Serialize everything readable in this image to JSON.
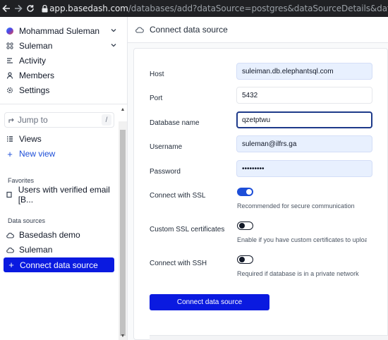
{
  "browser": {
    "url_host": "app.basedash.com",
    "url_path": "/databases/add?dataSource=postgres&dataSourceDetails&dataSourceName=Sulem"
  },
  "sidebar": {
    "user_name": "Mohammad Suleman",
    "workspace": "Suleman",
    "nav": {
      "activity": "Activity",
      "members": "Members",
      "settings": "Settings"
    },
    "jump_to": "Jump to",
    "jump_shortcut": "/",
    "views": "Views",
    "new_view": "New view",
    "favorites_heading": "Favorites",
    "favorite_item": "Users with verified email [B...",
    "data_sources_heading": "Data sources",
    "sources": [
      "Basedash demo",
      "Suleman"
    ],
    "connect_data_source": "Connect data source"
  },
  "main": {
    "title": "Connect data source",
    "form": {
      "host_label": "Host",
      "host_value": "suleiman.db.elephantsql.com",
      "port_label": "Port",
      "port_value": "5432",
      "dbname_label": "Database name",
      "dbname_value": "qzetptwu",
      "username_label": "Username",
      "username_value": "suleman@ilfrs.ga",
      "password_label": "Password",
      "password_value": "•••••••••",
      "ssl_label": "Connect with SSL",
      "ssl_on": true,
      "ssl_hint": "Recommended for secure communication",
      "custom_ssl_label": "Custom SSL certificates",
      "custom_ssl_on": false,
      "custom_ssl_hint": "Enable if you have custom certificates to upload",
      "ssh_label": "Connect with SSH",
      "ssh_on": false,
      "ssh_hint": "Required if database is in a private network",
      "submit_label": "Connect data source"
    }
  },
  "colors": {
    "accent": "#0a1ae0",
    "toggle_on": "#1d4ed8",
    "autofill": "#e8f0fe"
  }
}
